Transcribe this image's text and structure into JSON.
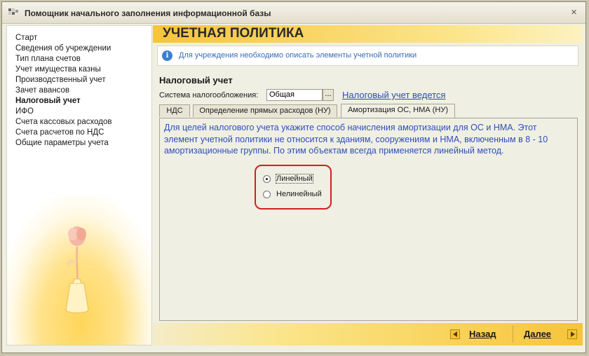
{
  "window": {
    "title": "Помощник начального заполнения информационной базы",
    "close_glyph": "×"
  },
  "sidebar": {
    "items": [
      {
        "label": "Старт"
      },
      {
        "label": "Сведения об учреждении"
      },
      {
        "label": "Тип плана счетов"
      },
      {
        "label": "Учет имущества казны"
      },
      {
        "label": "Производственный учет"
      },
      {
        "label": "Зачет авансов"
      },
      {
        "label": "Налоговый учет",
        "active": true
      },
      {
        "label": "ИФО"
      },
      {
        "label": "Счета кассовых расходов"
      },
      {
        "label": "Счета расчетов по НДС"
      },
      {
        "label": "Общие параметры учета"
      }
    ]
  },
  "main": {
    "page_title": "УЧЕТНАЯ ПОЛИТИКА",
    "info_icon_glyph": "i",
    "info_text": "Для учреждения необходимо описать элементы учетной политики",
    "section_title": "Налоговый учет",
    "tax_system": {
      "label": "Система налогообложения:",
      "value": "Общая",
      "select_button": "...",
      "link": "Налоговый учет ведется"
    },
    "tabs": [
      {
        "label": "НДС"
      },
      {
        "label": "Определение прямых расходов (НУ)"
      },
      {
        "label": "Амортизация ОС, НМА (НУ)",
        "active": true
      }
    ],
    "panel_text": "Для целей налогового учета укажите способ начисления амортизации для ОС и НМА. Этот элемент учетной политики не относится к зданиям, сооружениям и НМА, включенным в 8 - 10 амортизационные группы. По этим объектам всегда применяется линейный метод.",
    "depreciation_method": {
      "options": [
        {
          "label": "Линейный",
          "checked": true
        },
        {
          "label": "Нелинейный",
          "checked": false
        }
      ]
    }
  },
  "footer": {
    "back_label": "Назад",
    "next_label": "Далее"
  },
  "colors": {
    "accent_yellow": "#f7c43a",
    "link_blue": "#2a4ea8",
    "highlight_red": "#d02020"
  },
  "icons": [
    "app-icon",
    "close-icon",
    "info-icon",
    "arrow-left-icon",
    "arrow-right-icon",
    "flower-vase-icon"
  ]
}
